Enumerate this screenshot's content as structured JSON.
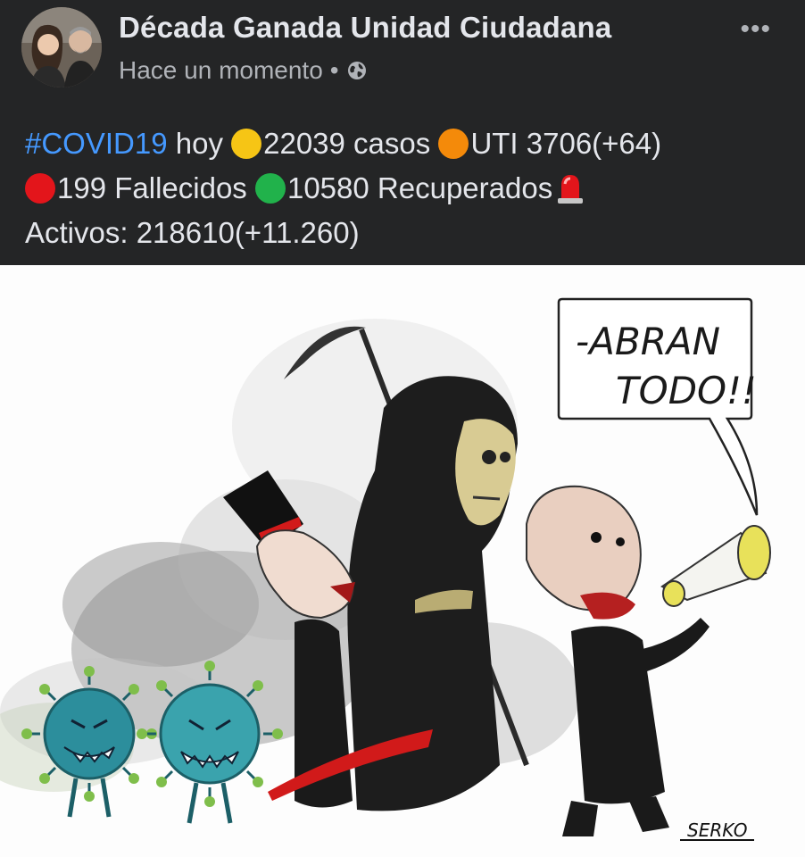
{
  "post": {
    "author": "Década Ganada Unidad Ciudadana",
    "timestamp": "Hace un momento",
    "separator": "•",
    "privacy_icon": "globe-icon",
    "more_icon": "more-options-icon",
    "more_label": "•••"
  },
  "text": {
    "hashtag": "#COVID19",
    "line1_a": " hoy ",
    "cases": "22039 casos ",
    "uti": "UTI 3706(+64)",
    "deaths": "199 Fallecidos ",
    "recovered": "10580 Recuperados",
    "active": "Activos: 218610(+11.260)"
  },
  "emoji": {
    "yellow": "#f6c515",
    "orange": "#f48a0a",
    "red": "#e3151b",
    "green": "#21b24b"
  },
  "cartoon": {
    "speech_line1": "-ABRAN",
    "speech_line2": "TODO!!",
    "signature": "SERKO"
  },
  "colors": {
    "background": "#242526",
    "text": "#e4e6eb",
    "secondary": "#b0b3b8",
    "link": "#4599ff"
  }
}
